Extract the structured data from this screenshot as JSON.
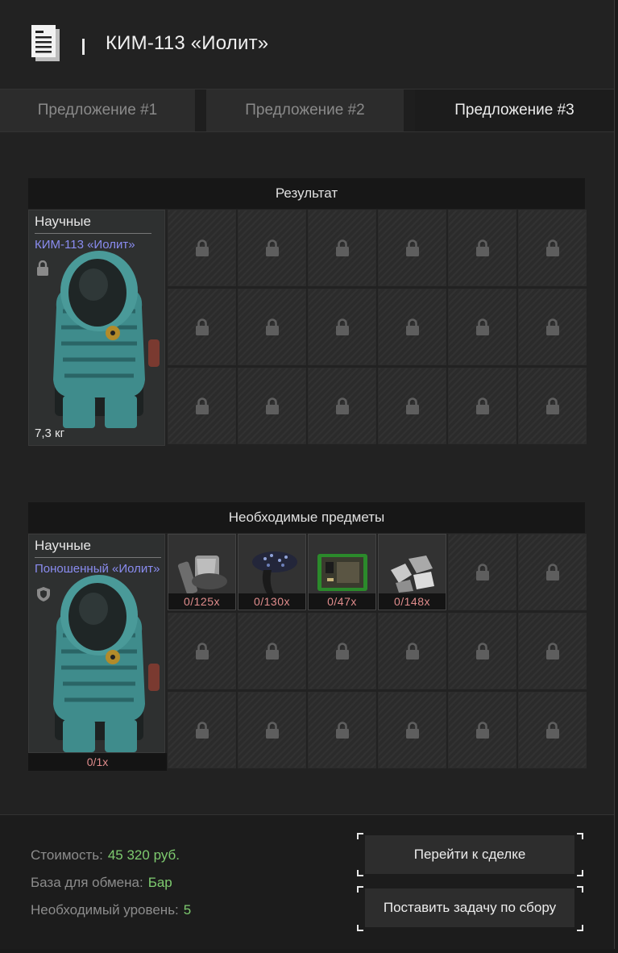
{
  "header": {
    "title": "КИМ-113 «Иолит»"
  },
  "tabs": [
    {
      "label": "Предложение #1",
      "active": false
    },
    {
      "label": "Предложение #2",
      "active": false
    },
    {
      "label": "Предложение #3",
      "active": true
    }
  ],
  "result": {
    "heading": "Результат",
    "item": {
      "category": "Научные",
      "name": "КИМ-113 «Иолит»",
      "weight": "7,3 кг"
    },
    "locked_slots": 18
  },
  "required": {
    "heading": "Необходимые предметы",
    "item": {
      "category": "Научные",
      "name": "Поношенный «Иолит»",
      "count": "0/1x"
    },
    "materials": [
      {
        "icon": "tool-material-icon",
        "count": "0/125x"
      },
      {
        "icon": "crystal-mushroom-icon",
        "count": "0/130x"
      },
      {
        "icon": "circuit-board-icon",
        "count": "0/47x"
      },
      {
        "icon": "metal-scrap-icon",
        "count": "0/148x"
      }
    ],
    "locked_slots": 14
  },
  "footer": {
    "cost_label": "Стоимость:",
    "cost_value": "45 320 руб.",
    "base_label": "База для обмена:",
    "base_value": "Бар",
    "level_label": "Необходимый уровень:",
    "level_value": "5",
    "goto_deal_label": "Перейти к сделке",
    "set_task_label": "Поставить задачу по сбору"
  },
  "colors": {
    "accent_name": "#8a8cf0",
    "value_green": "#7ecb6f",
    "count_red": "#e08c8c"
  }
}
